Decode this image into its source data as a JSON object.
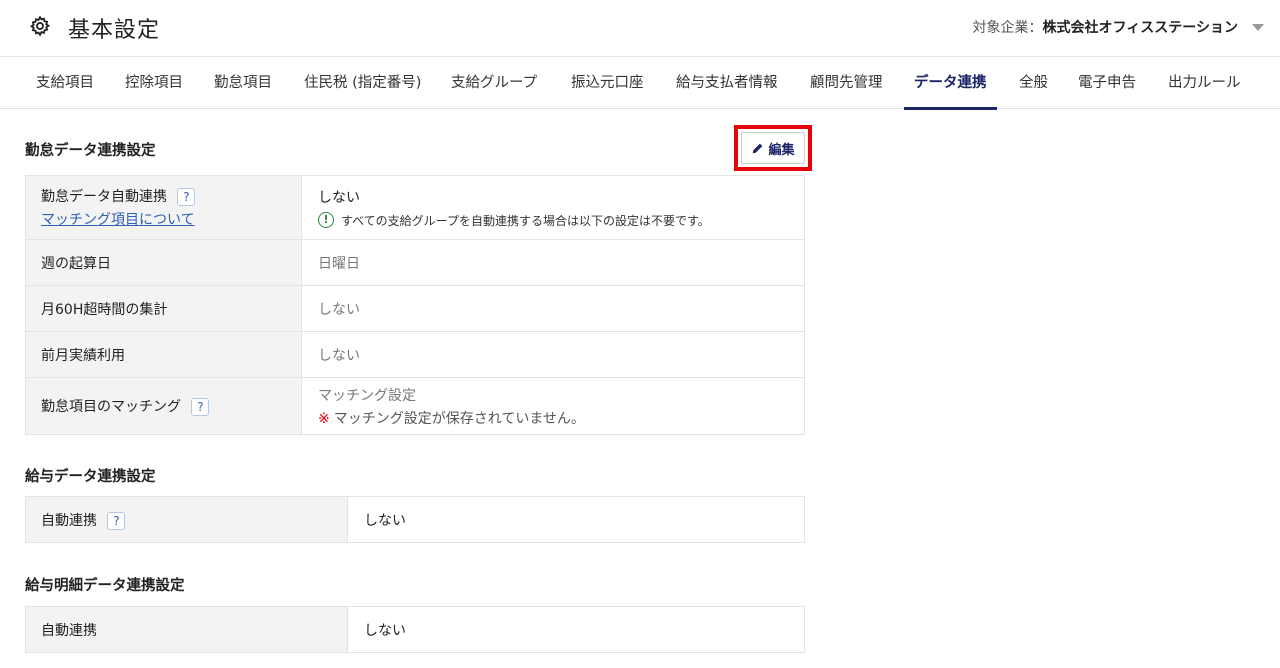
{
  "header": {
    "title": "基本設定",
    "company_label": "対象企業：",
    "company_name": "株式会社オフィスステーション"
  },
  "tabs": [
    {
      "label": "支給項目"
    },
    {
      "label": "控除項目"
    },
    {
      "label": "勤怠項目"
    },
    {
      "label": "住民税 (指定番号)"
    },
    {
      "label": "支給グループ"
    },
    {
      "label": "振込元口座"
    },
    {
      "label": "給与支払者情報"
    },
    {
      "label": "顧問先管理"
    },
    {
      "label": "データ連携",
      "active": true
    },
    {
      "label": "全般"
    },
    {
      "label": "電子申告"
    },
    {
      "label": "出力ルール"
    }
  ],
  "attendance": {
    "title": "勤怠データ連携設定",
    "edit_label": "編集",
    "auto_link_label": "勤怠データ自動連携",
    "matching_link": "マッチング項目について",
    "auto_link_value": "しない",
    "auto_link_note": "すべての支給グループを自動連携する場合は以下の設定は不要です。",
    "week_start_label": "週の起算日",
    "week_start_value": "日曜日",
    "overtime_label": "月60H超時間の集計",
    "overtime_value": "しない",
    "prev_month_label": "前月実績利用",
    "prev_month_value": "しない",
    "matching_label": "勤怠項目のマッチング",
    "matching_value": "マッチング設定",
    "matching_warn_mark": "※",
    "matching_warn": "マッチング設定が保存されていません。"
  },
  "salary": {
    "title": "給与データ連携設定",
    "auto_label": "自動連携",
    "auto_value": "しない"
  },
  "payslip": {
    "title": "給与明細データ連携設定",
    "auto_label": "自動連携",
    "auto_value": "しない"
  },
  "help_mark": "?",
  "note_mark": "!",
  "colors": {
    "accent": "#1c2466",
    "highlight": "#e8000b",
    "link": "#2d5fb3",
    "info": "#2c8a3c"
  }
}
